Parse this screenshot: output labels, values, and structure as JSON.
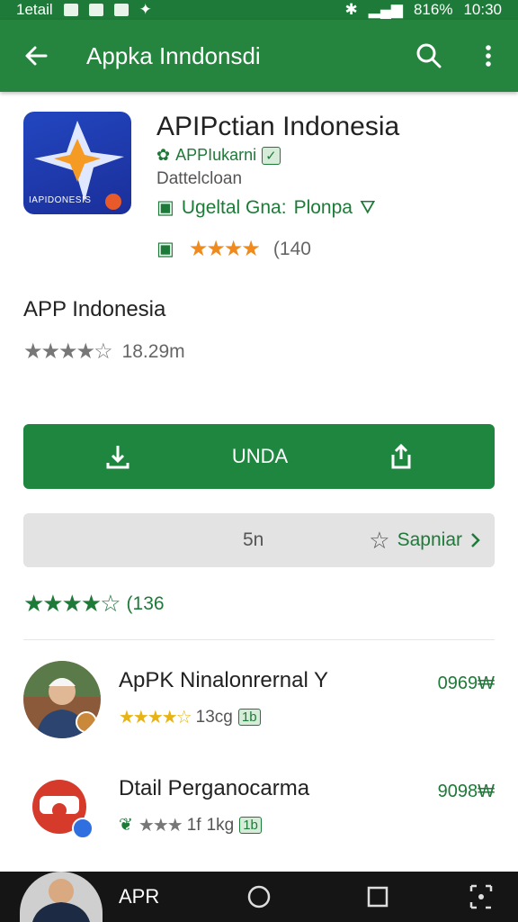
{
  "status_bar": {
    "left_text": "1etail",
    "battery": "816%",
    "time": "10:30"
  },
  "app_bar": {
    "title": "Appka Inndonsdi"
  },
  "app": {
    "name": "APIPctian Indonesia",
    "developer": "APPIukarni",
    "category": "Dattelcloan",
    "age_label": "Ugeltal Gna:",
    "age_value": "Plonpa",
    "rating_count": "(140",
    "icon_text": "IAPIDONESIS"
  },
  "secondary": {
    "title": "APP Indonesia",
    "rating_text": "18.29m"
  },
  "install_button": {
    "label": "UNDA"
  },
  "wishlist": {
    "count": "5n",
    "action_label": "Sapniar"
  },
  "reviews": {
    "count_text": "(136"
  },
  "list": [
    {
      "name": "ApPK Ninalonrernal Y",
      "meta": "13cg",
      "tag": "1b",
      "price": "0969₩"
    },
    {
      "name": "Dtail Perganocarma",
      "meta": "1kg",
      "prefix": "1f",
      "tag": "1b",
      "price": "9098₩"
    }
  ],
  "nav_bar": {
    "label": "APR"
  },
  "colors": {
    "primary": "#25843e",
    "star_orange": "#f08a1c",
    "star_gold": "#e8b315"
  }
}
